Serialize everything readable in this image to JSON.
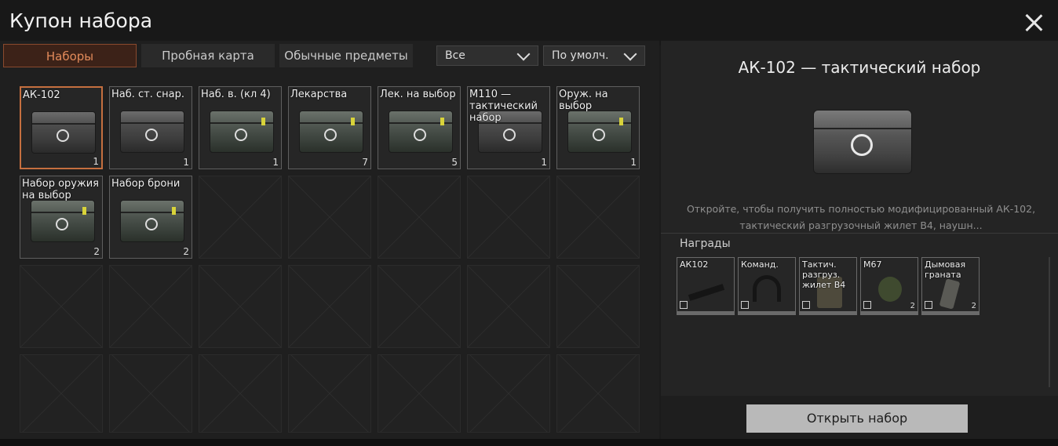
{
  "window": {
    "title": "Купон набора"
  },
  "tabs": [
    {
      "label": "Наборы",
      "active": true
    },
    {
      "label": "Пробная карта",
      "active": false
    },
    {
      "label": "Обычные предметы",
      "active": false
    }
  ],
  "filters": {
    "category": "Все",
    "sort": "По умолч."
  },
  "items": [
    {
      "name": "АК-102",
      "count": "1",
      "selected": true
    },
    {
      "name": "Наб. ст. снар.",
      "count": "1"
    },
    {
      "name": "Наб. в. (кл 4)",
      "count": "1"
    },
    {
      "name": "Лекарства",
      "count": "7"
    },
    {
      "name": "Лек. на выбор",
      "count": "5"
    },
    {
      "name": "М110 — тактический набор",
      "count": "1"
    },
    {
      "name": "Оруж. на выбор",
      "count": "1"
    },
    {
      "name": "Набор оружия на выбор",
      "count": "2"
    },
    {
      "name": "Набор брони",
      "count": "2"
    }
  ],
  "detail": {
    "title": "АК-102 — тактический набор",
    "description": "Откройте, чтобы получить полностью модифицированный АК-102, тактический разгрузочный жилет В4, наушн...",
    "rewards_label": "Награды",
    "rewards": [
      {
        "name": "АК102",
        "count": ""
      },
      {
        "name": "Команд.",
        "count": ""
      },
      {
        "name": "Тактич. разгруз. жилет В4",
        "count": ""
      },
      {
        "name": "М67",
        "count": "2"
      },
      {
        "name": "Дымовая граната",
        "count": "2"
      }
    ],
    "open_button": "Открыть набор"
  },
  "colors": {
    "accent": "#c56f3f",
    "background": "#1b1b1b"
  }
}
